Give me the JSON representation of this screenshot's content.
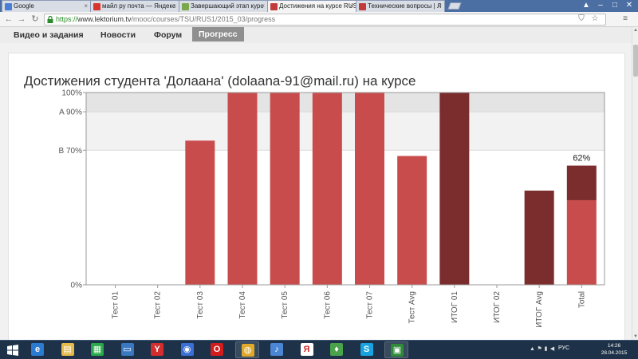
{
  "browser": {
    "tabs": [
      {
        "label": "Google",
        "favicon_color": "#4a7fd6",
        "active": false
      },
      {
        "label": "майл ру почта — Яндекс",
        "favicon_color": "#d9342b",
        "active": false
      },
      {
        "label": "Завершающий этап курс",
        "favicon_color": "#7aa84a",
        "active": false
      },
      {
        "label": "Достижения на курсе RUS",
        "favicon_color": "#c33a3a",
        "active": true
      },
      {
        "label": "Технические вопросы | Л",
        "favicon_color": "#c33a3a",
        "active": false
      }
    ],
    "url_scheme": "https://",
    "url_host": "www.lektorium.tv",
    "url_path": "/mooc/courses/TSU/RUS1/2015_03/progress"
  },
  "site_nav": {
    "items": [
      {
        "label": "Видео и задания",
        "active": false
      },
      {
        "label": "Новости",
        "active": false
      },
      {
        "label": "Форум",
        "active": false
      },
      {
        "label": "Прогресс",
        "active": true
      }
    ]
  },
  "page": {
    "title": "Достижения студента 'Долаана' (dolaana-91@mail.ru) на курсе"
  },
  "chart_data": {
    "type": "bar",
    "categories": [
      "Тест 01",
      "Тест 02",
      "Тест 03",
      "Тест 04",
      "Тест 05",
      "Тест 06",
      "Тест 07",
      "Тест Avg",
      "ИТОГ 01",
      "ИТОГ 02",
      "ИТОГ Avg",
      "Total"
    ],
    "values": [
      0,
      0,
      75,
      100,
      100,
      100,
      100,
      67,
      100,
      0,
      49,
      62
    ],
    "total_segments": [
      44,
      18
    ],
    "bar_colors": [
      "#c94c4c",
      "#c94c4c",
      "#c94c4c",
      "#c94c4c",
      "#c94c4c",
      "#c94c4c",
      "#c94c4c",
      "#c94c4c",
      "#7b2c2c",
      "#7b2c2c",
      "#7b2c2c",
      "#c94c4c"
    ],
    "total_top_color": "#7b2c2c",
    "total_label": "62%",
    "y_ticks": [
      {
        "value": 100,
        "label": "100%"
      },
      {
        "value": 90,
        "label": "A 90%"
      },
      {
        "value": 70,
        "label": "B 70%"
      },
      {
        "value": 0,
        "label": "0%"
      }
    ],
    "bands": [
      {
        "from": 90,
        "to": 100,
        "color": "#e4e4e4"
      },
      {
        "from": 70,
        "to": 90,
        "color": "#f2f2f2"
      }
    ],
    "ylim": [
      0,
      100
    ],
    "grid": false
  },
  "taskbar": {
    "apps": [
      {
        "name": "ie-icon",
        "color": "#2b7bd1",
        "glyph": "e",
        "open": false
      },
      {
        "name": "explorer-icon",
        "color": "#e5b94a",
        "glyph": "▤",
        "open": false
      },
      {
        "name": "store-icon",
        "color": "#2aa94a",
        "glyph": "▦",
        "open": false
      },
      {
        "name": "monitor-icon",
        "color": "#3a78c2",
        "glyph": "▭",
        "open": false
      },
      {
        "name": "yandex-icon",
        "color": "#d22e2e",
        "glyph": "Y",
        "open": false
      },
      {
        "name": "compass-icon",
        "color": "#3b6fd6",
        "glyph": "◉",
        "open": false
      },
      {
        "name": "opera-icon",
        "color": "#d31c1c",
        "glyph": "O",
        "open": false
      },
      {
        "name": "chrome-icon",
        "color": "#e0a92a",
        "glyph": "◍",
        "open": true
      },
      {
        "name": "volume-app-icon",
        "color": "#4a86d4",
        "glyph": "♪",
        "open": false
      },
      {
        "name": "yandex-browser-icon",
        "color": "#ffffff",
        "glyph": "Я",
        "open": false
      },
      {
        "name": "solitaire-icon",
        "color": "#4aa34a",
        "glyph": "♦",
        "open": false
      },
      {
        "name": "skype-icon",
        "color": "#17a3e0",
        "glyph": "S",
        "open": false
      },
      {
        "name": "green-app-icon",
        "color": "#2f8a3a",
        "glyph": "▣",
        "open": true
      }
    ],
    "lang": "РУС",
    "time": "14:26",
    "date": "28.04.2015"
  }
}
